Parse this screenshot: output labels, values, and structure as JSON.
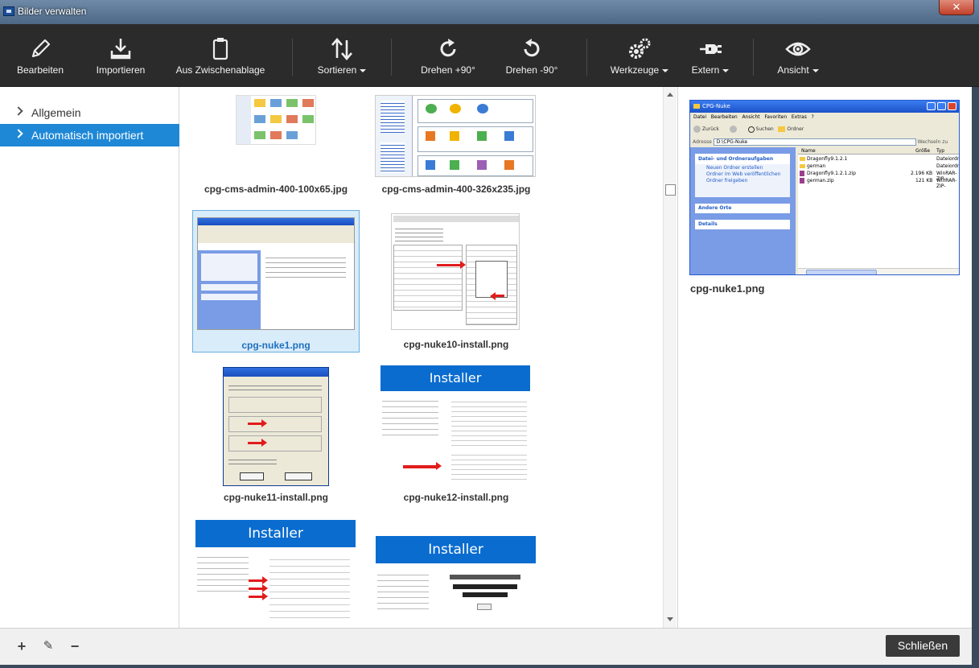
{
  "window": {
    "title": "Bilder verwalten",
    "close_glyph": "✕"
  },
  "toolbar": {
    "items": [
      {
        "label": "Bearbeiten",
        "icon": "pencil-icon"
      },
      {
        "label": "Importieren",
        "icon": "import-tray-icon"
      },
      {
        "label": "Aus Zwischenablage",
        "icon": "clipboard-icon"
      },
      {
        "label": "Sortieren",
        "icon": "sort-arrows-icon",
        "dropdown": true
      },
      {
        "label": "Drehen +90°",
        "icon": "rotate-clockwise-icon"
      },
      {
        "label": "Drehen -90°",
        "icon": "rotate-counterclockwise-icon"
      },
      {
        "label": "Werkzeuge",
        "icon": "gears-icon",
        "dropdown": true
      },
      {
        "label": "Extern",
        "icon": "plug-icon",
        "dropdown": true
      },
      {
        "label": "Ansicht",
        "icon": "eye-icon",
        "dropdown": true
      }
    ]
  },
  "sidebar": {
    "items": [
      {
        "label": "Allgemein",
        "active": false
      },
      {
        "label": "Automatisch importiert",
        "active": true
      }
    ]
  },
  "gallery": {
    "items": [
      {
        "caption": "cpg-cms-admin-400-100x65.jpg"
      },
      {
        "caption": "cpg-cms-admin-400-326x235.jpg"
      },
      {
        "caption": "cpg-nuke1.png",
        "selected": true
      },
      {
        "caption": "cpg-nuke10-install.png"
      },
      {
        "caption": "cpg-nuke11-install.png"
      },
      {
        "caption": "cpg-nuke12-install.png"
      },
      {
        "caption": ""
      },
      {
        "caption": ""
      }
    ],
    "installer_heading": "Installer"
  },
  "preview": {
    "caption": "cpg-nuke1.png",
    "window_title": "CPG-Nuke",
    "menu": [
      "Datei",
      "Bearbeiten",
      "Ansicht",
      "Favoriten",
      "Extras",
      "?"
    ],
    "back_label": "Zurück",
    "search_label": "Suchen",
    "folders_label": "Ordner",
    "address_label": "Adresse",
    "address_value": "D:\\CPG-Nuke",
    "go_label": "Wechseln zu",
    "task_panel_title": "Datei- und Ordneraufgaben",
    "tasks": [
      "Neuen Ordner erstellen",
      "Ordner im Web veröffentlichen",
      "Ordner freigeben"
    ],
    "other_places": "Andere Orte",
    "details": "Details",
    "columns": {
      "name": "Name",
      "size": "Größe",
      "type": "Typ"
    },
    "files": [
      {
        "name": "Dragonfly9.1.2.1",
        "size": "",
        "type": "Dateiordner"
      },
      {
        "name": "german",
        "size": "",
        "type": "Dateiordner"
      },
      {
        "name": "Dragonfly9.1.2.1.zip",
        "size": "2.196 KB",
        "type": "WinRAR-ZIP-"
      },
      {
        "name": "german.zip",
        "size": "121 KB",
        "type": "WinRAR-ZIP-"
      }
    ]
  },
  "bottombar": {
    "add_glyph": "+",
    "edit_glyph": "✎",
    "remove_glyph": "−",
    "close_label": "Schließen"
  }
}
